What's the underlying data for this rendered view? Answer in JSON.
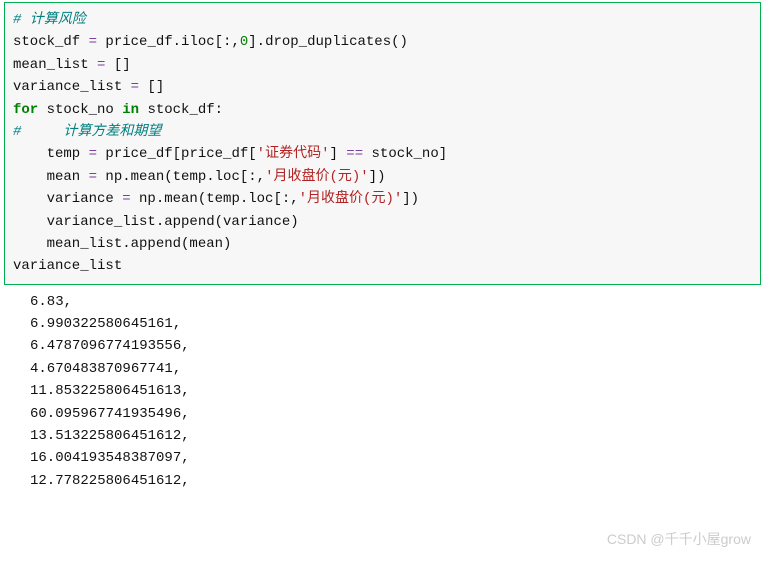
{
  "code": {
    "lines": [
      [
        {
          "cls": "comment",
          "t": "# 计算风险"
        }
      ],
      [
        {
          "cls": "",
          "t": "stock_df "
        },
        {
          "cls": "op",
          "t": "="
        },
        {
          "cls": "",
          "t": " price_df.iloc[:,"
        },
        {
          "cls": "number",
          "t": "0"
        },
        {
          "cls": "",
          "t": "].drop_duplicates()"
        }
      ],
      [
        {
          "cls": "",
          "t": "mean_list "
        },
        {
          "cls": "op",
          "t": "="
        },
        {
          "cls": "",
          "t": " []"
        }
      ],
      [
        {
          "cls": "",
          "t": "variance_list "
        },
        {
          "cls": "op",
          "t": "="
        },
        {
          "cls": "",
          "t": " []"
        }
      ],
      [
        {
          "cls": "keyword",
          "t": "for"
        },
        {
          "cls": "",
          "t": " stock_no "
        },
        {
          "cls": "keyword",
          "t": "in"
        },
        {
          "cls": "",
          "t": " stock_df:"
        }
      ],
      [
        {
          "cls": "comment",
          "t": "#     计算方差和期望"
        }
      ],
      [
        {
          "cls": "",
          "t": "    temp "
        },
        {
          "cls": "op",
          "t": "="
        },
        {
          "cls": "",
          "t": " price_df[price_df["
        },
        {
          "cls": "string",
          "t": "'证券代码'"
        },
        {
          "cls": "",
          "t": "] "
        },
        {
          "cls": "op",
          "t": "=="
        },
        {
          "cls": "",
          "t": " stock_no]"
        }
      ],
      [
        {
          "cls": "",
          "t": "    mean "
        },
        {
          "cls": "op",
          "t": "="
        },
        {
          "cls": "",
          "t": " np.mean(temp.loc[:,"
        },
        {
          "cls": "string",
          "t": "'月收盘价(元)'"
        },
        {
          "cls": "",
          "t": "])"
        }
      ],
      [
        {
          "cls": "",
          "t": "    variance "
        },
        {
          "cls": "op",
          "t": "="
        },
        {
          "cls": "",
          "t": " np.mean(temp.loc[:,"
        },
        {
          "cls": "string",
          "t": "'月收盘价(元)'"
        },
        {
          "cls": "",
          "t": "])"
        }
      ],
      [
        {
          "cls": "",
          "t": "    variance_list.append(variance)"
        }
      ],
      [
        {
          "cls": "",
          "t": "    mean_list.append(mean)"
        }
      ],
      [
        {
          "cls": "",
          "t": "variance_list"
        }
      ]
    ]
  },
  "output": {
    "lines": [
      "6.83,",
      "6.990322580645161,",
      "6.4787096774193556,",
      "4.670483870967741,",
      "11.853225806451613,",
      "60.095967741935496,",
      "13.513225806451612,",
      "16.004193548387097,",
      "12.778225806451612,"
    ]
  },
  "watermark": "CSDN @千千小屋grow"
}
